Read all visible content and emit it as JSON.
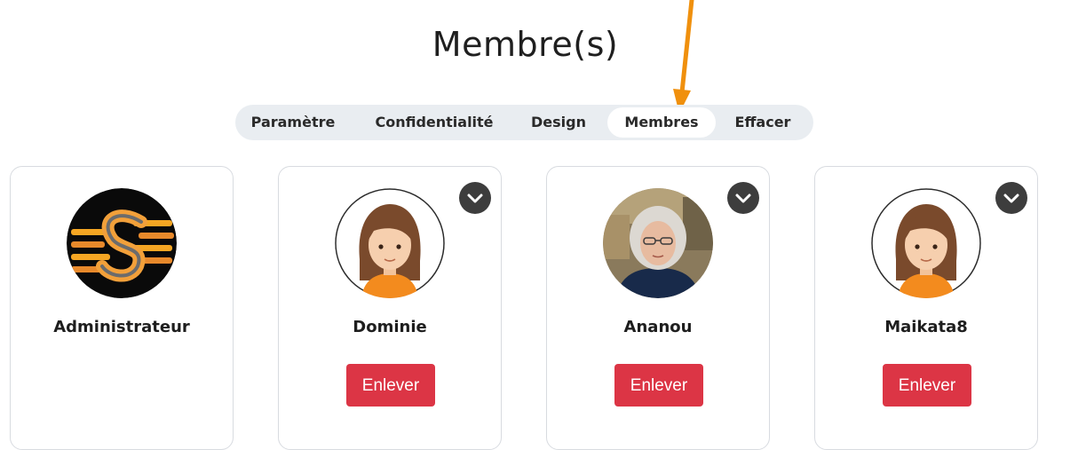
{
  "page": {
    "title": "Membre(s)"
  },
  "tabs": [
    {
      "label": "Paramètre",
      "active": false
    },
    {
      "label": "Confidentialité",
      "active": false
    },
    {
      "label": "Design",
      "active": false
    },
    {
      "label": "Membres",
      "active": true
    },
    {
      "label": "Effacer",
      "active": false
    }
  ],
  "members": [
    {
      "name": "Administrateur",
      "avatar": "logo-s-avatar",
      "removable": false
    },
    {
      "name": "Dominie",
      "avatar": "default-female-avatar",
      "removable": true,
      "remove_label": "Enlever"
    },
    {
      "name": "Ananou",
      "avatar": "photo-avatar",
      "removable": true,
      "remove_label": "Enlever"
    },
    {
      "name": "Maikata8",
      "avatar": "default-female-avatar",
      "removable": true,
      "remove_label": "Enlever"
    }
  ],
  "icons": {
    "card_menu": "chevron-down-icon",
    "annotation": "orange-arrow-annotation"
  },
  "colors": {
    "remove_button": "#dc3545",
    "tab_bar": "#e9edf1",
    "active_tab": "#ffffff",
    "annotation_arrow": "#f0900d",
    "menu_button": "#3d3d3d"
  }
}
